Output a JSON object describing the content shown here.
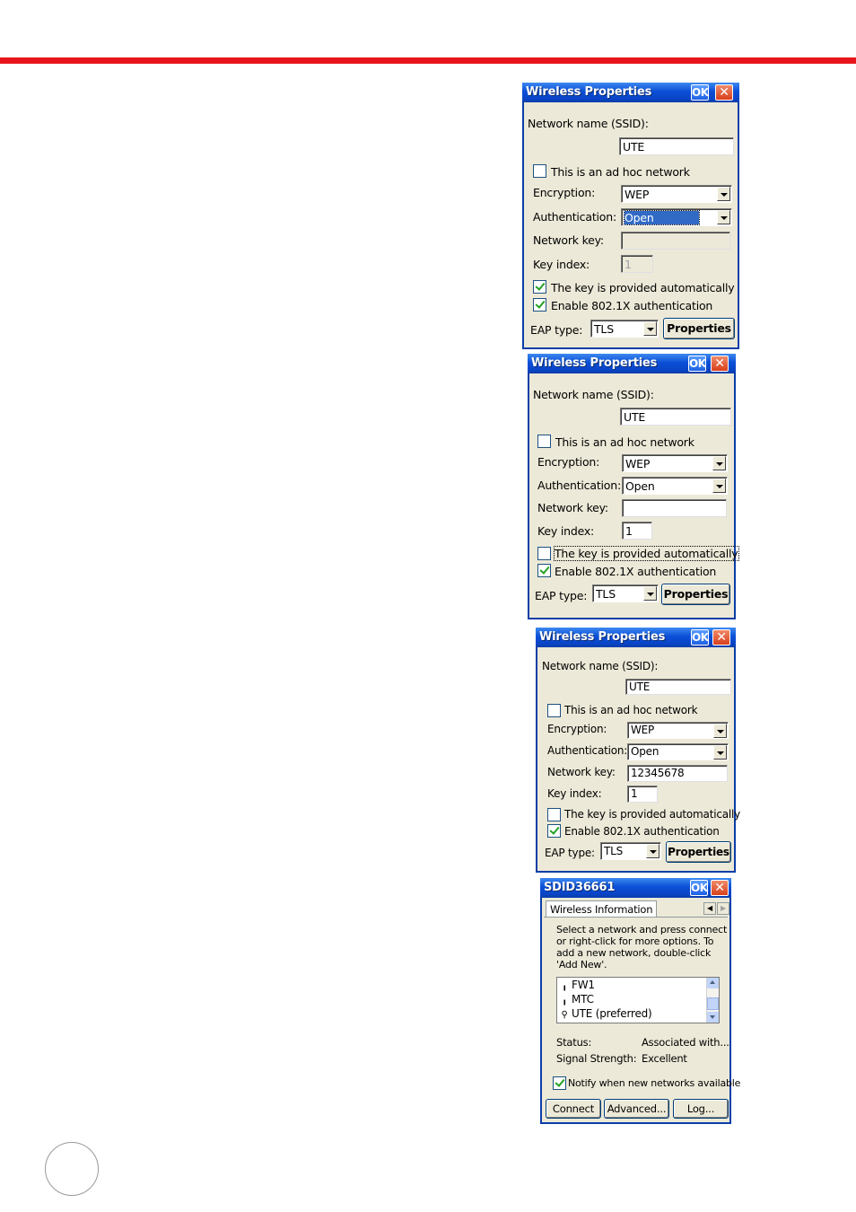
{
  "dialog1": {
    "title": "Wireless Properties",
    "ok": "OK",
    "close": "✕",
    "ssid_label": "Network name (SSID):",
    "ssid_value": "UTE",
    "adhoc_label": "This is an ad hoc network",
    "adhoc_checked": false,
    "encryption_label": "Encryption:",
    "encryption_value": "WEP",
    "authentication_label": "Authentication:",
    "authentication_value": "Open",
    "network_key_label": "Network key:",
    "network_key_value": "",
    "key_index_label": "Key index:",
    "key_index_value": "1",
    "key_auto_label": "The key is provided automatically",
    "key_auto_checked": true,
    "enable_8021x_label": "Enable 802.1X authentication",
    "enable_8021x_checked": true,
    "eap_type_label": "EAP type:",
    "eap_type_value": "TLS",
    "properties_button": "Properties"
  },
  "dialog2": {
    "title": "Wireless Properties",
    "ok": "OK",
    "close": "✕",
    "ssid_label": "Network name (SSID):",
    "ssid_value": "UTE",
    "adhoc_label": "This is an ad hoc network",
    "adhoc_checked": false,
    "encryption_label": "Encryption:",
    "encryption_value": "WEP",
    "authentication_label": "Authentication:",
    "authentication_value": "Open",
    "network_key_label": "Network key:",
    "network_key_value": "",
    "key_index_label": "Key index:",
    "key_index_value": "1",
    "key_auto_label": "The key is provided automatically",
    "key_auto_checked": false,
    "enable_8021x_label": "Enable 802.1X authentication",
    "enable_8021x_checked": true,
    "eap_type_label": "EAP type:",
    "eap_type_value": "TLS",
    "properties_button": "Properties"
  },
  "dialog3": {
    "title": "Wireless Properties",
    "ok": "OK",
    "close": "✕",
    "ssid_label": "Network name (SSID):",
    "ssid_value": "UTE",
    "adhoc_label": "This is an ad hoc network",
    "adhoc_checked": false,
    "encryption_label": "Encryption:",
    "encryption_value": "WEP",
    "authentication_label": "Authentication:",
    "authentication_value": "Open",
    "network_key_label": "Network key:",
    "network_key_value": "12345678",
    "key_index_label": "Key index:",
    "key_index_value": "1",
    "key_auto_label": "The key is provided automatically",
    "key_auto_checked": false,
    "enable_8021x_label": "Enable 802.1X authentication",
    "enable_8021x_checked": true,
    "eap_type_label": "EAP type:",
    "eap_type_value": "TLS",
    "properties_button": "Properties"
  },
  "dialog4": {
    "title": "SDID36661",
    "ok": "OK",
    "close": "✕",
    "tab_label": "Wireless Information",
    "instructions": [
      "Select a network and press connect",
      "or right-click for more options.  To",
      "add a new network, double-click",
      "'Add New'."
    ],
    "networks": [
      {
        "name": "FW1",
        "icon": "antenna-icon"
      },
      {
        "name": "MTC",
        "icon": "antenna-icon"
      },
      {
        "name": "UTE (preferred)",
        "icon": "key-icon"
      }
    ],
    "status_label": "Status:",
    "status_value": "Associated with...",
    "signal_label": "Signal Strength:",
    "signal_value": "Excellent",
    "notify_label": "Notify when new networks available",
    "notify_checked": true,
    "connect_button": "Connect",
    "advanced_button": "Advanced...",
    "log_button": "Log..."
  },
  "colors": {
    "accent_bar": "#e8141c",
    "titlebar": "#0b4fd6",
    "dialog_bg": "#ece9d8",
    "selection": "#316ac5"
  }
}
